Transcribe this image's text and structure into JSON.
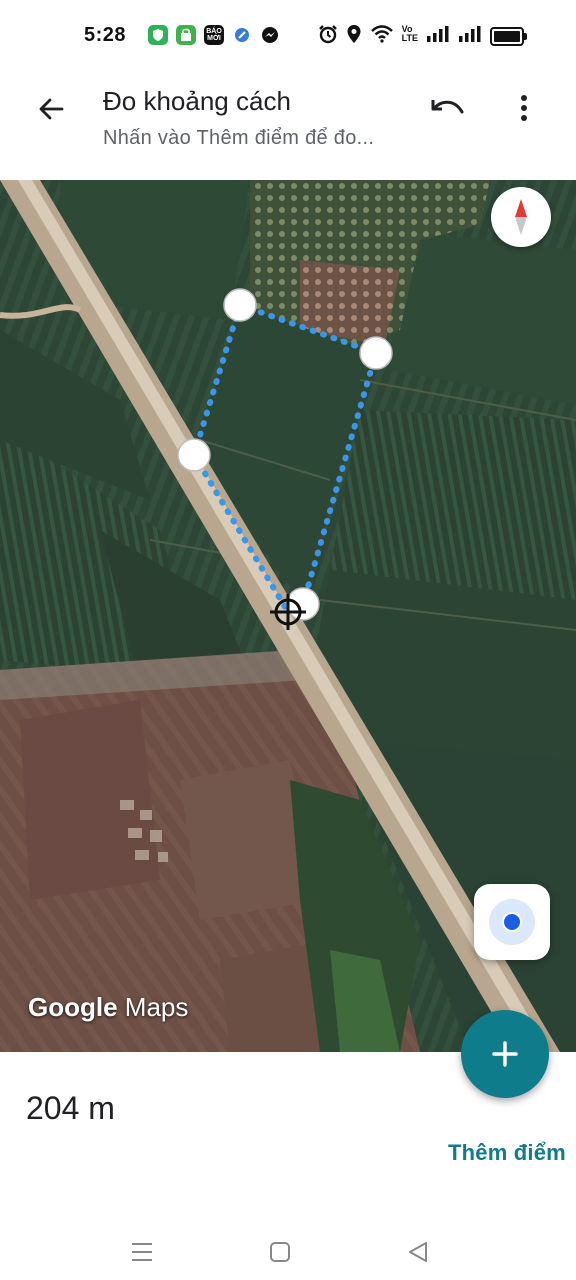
{
  "status_bar": {
    "time": "5:28",
    "notification_icons": [
      "shield-app-icon",
      "shopping-app-icon",
      "bao-moi-icon",
      "blue-app-icon",
      "messenger-icon"
    ],
    "bao_moi_label": "BÁO\nMỚI",
    "system_icons": [
      "alarm-icon",
      "location-icon",
      "wifi-icon",
      "volte-icon",
      "signal-icon",
      "signal-icon",
      "battery-icon"
    ],
    "volte_label": "Vo\nLTE",
    "battery_level": 0.85
  },
  "app_bar": {
    "title": "Đo khoảng cách",
    "subtitle": "Nhấn vào Thêm điểm để đo..."
  },
  "map": {
    "watermark_google": "Google",
    "watermark_maps": "Maps",
    "measure_line_color": "#3b95e8",
    "compass_north_color": "#e53935"
  },
  "bottom_panel": {
    "distance": "204 m",
    "add_point_label": "Thêm điểm"
  },
  "colors": {
    "accent": "#0f7c8c"
  }
}
